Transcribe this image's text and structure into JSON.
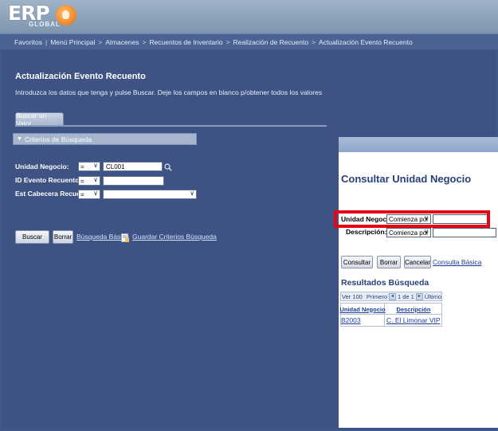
{
  "header": {
    "logo_text": "ERP",
    "logo_sub": "GLOBAL"
  },
  "breadcrumb": [
    "Favoritos",
    "Menú Principal",
    "Almacenes",
    "Recuentos de Inventario",
    "Realización de Recuento",
    "Actualización Evento Recuento"
  ],
  "breadcrumb_separators": [
    "|",
    ">",
    ">",
    ">",
    ">"
  ],
  "page": {
    "title": "Actualización Evento Recuento",
    "instructions": "Introduzca los datos que tenga y pulse Buscar. Deje los campos en blanco p/obtener todos los valores",
    "tab": "Buscar un Valor",
    "section": "Criterios de Búsqueda"
  },
  "form": {
    "unidad_negocio": {
      "label": "Unidad Negocio:",
      "operator": "=",
      "value": "CL001"
    },
    "id_evento": {
      "label": "ID Evento Recuento:",
      "operator": "=",
      "value": ""
    },
    "est_cabecera": {
      "label": "Est Cabecera Recuento:",
      "operator": "=",
      "value": ""
    }
  },
  "actions": {
    "buscar": "Buscar",
    "borrar": "Borrar",
    "busqueda_basica": "Búsqueda Básica",
    "guardar": "Guardar Criterios Búsqueda"
  },
  "modal": {
    "title": "Consultar Unidad Negocio",
    "unidad_label": "Unidad Negocio:",
    "unidad_operator": "Comienza por",
    "descripcion_label": "Descripción:",
    "descripcion_operator": "Comienza por",
    "consultar": "Consultar",
    "borrar": "Borrar",
    "cancelar": "Cancelar",
    "consulta_basica": "Consulta Básica",
    "results_title": "Resultados Búsqueda",
    "nav": {
      "ver": "Ver 100",
      "primero": "Primero",
      "range": "1 de 1",
      "ultimo": "Último"
    },
    "columns": [
      "Unidad Negocio",
      "Descripción"
    ],
    "rows": [
      {
        "unidad": "B2003",
        "descripcion": "C. El Limonar VIP"
      }
    ]
  },
  "colors": {
    "frame": "#3e5383",
    "highlight": "#e30613",
    "modal_title": "#27427a"
  }
}
